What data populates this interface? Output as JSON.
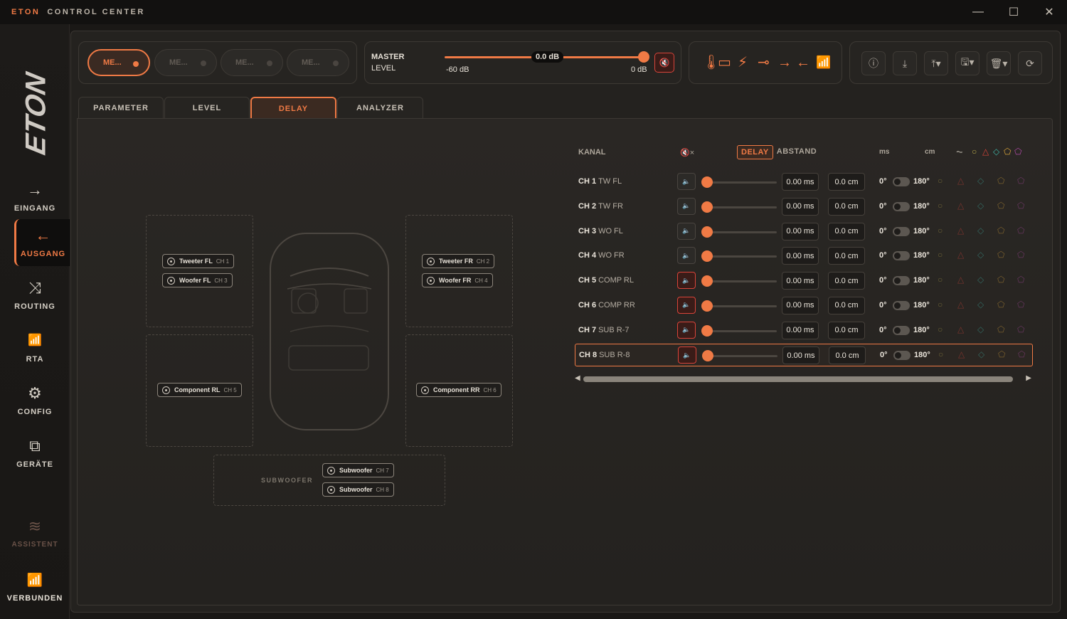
{
  "app": {
    "brand": "ETON",
    "title": "CONTROL CENTER"
  },
  "window": {
    "minimize": "—",
    "maximize": "☐",
    "close": "✕"
  },
  "sidebar": {
    "logo": "ETON",
    "items": [
      {
        "label": "EINGANG",
        "icon": "→"
      },
      {
        "label": "AUSGANG",
        "icon": "←"
      },
      {
        "label": "ROUTING",
        "icon": "⤨"
      },
      {
        "label": "RTA",
        "icon": "📶"
      },
      {
        "label": "CONFIG",
        "icon": "⚙"
      },
      {
        "label": "GERÄTE",
        "icon": "⧉"
      },
      {
        "label": "ASSISTENT",
        "icon": "≋"
      },
      {
        "label": "VERBUNDEN",
        "icon": "📶"
      }
    ]
  },
  "memories": [
    {
      "label": "ME...",
      "active": true
    },
    {
      "label": "ME...",
      "active": false
    },
    {
      "label": "ME...",
      "active": false
    },
    {
      "label": "ME...",
      "active": false
    }
  ],
  "master": {
    "title": "MASTER",
    "subtitle": "LEVEL",
    "min": "-60 dB",
    "max": "0 dB",
    "value": "0.0 dB",
    "level": 1.0,
    "mute_icon": "🔇"
  },
  "status_icons": [
    "🌡",
    "▭",
    "⚡",
    "⊸",
    "→",
    "←",
    "📶"
  ],
  "tools": [
    "ⓘ",
    "⤓",
    "⤒▾",
    "🖫▾",
    "🗑▾",
    "⟳"
  ],
  "tabs": [
    {
      "label": "PARAMETER",
      "active": false
    },
    {
      "label": "LEVEL",
      "active": false
    },
    {
      "label": "DELAY",
      "active": true
    },
    {
      "label": "ANALYZER",
      "active": false
    }
  ],
  "car": {
    "front_left": [
      {
        "name": "Tweeter FL",
        "ch": "CH 1"
      },
      {
        "name": "Woofer FL",
        "ch": "CH 3"
      }
    ],
    "front_right": [
      {
        "name": "Tweeter FR",
        "ch": "CH 2"
      },
      {
        "name": "Woofer FR",
        "ch": "CH 4"
      }
    ],
    "rear_left": {
      "name": "Component RL",
      "ch": "CH 5"
    },
    "rear_right": {
      "name": "Component RR",
      "ch": "CH 6"
    },
    "subwoofer_label": "SUBWOOFER",
    "subwoofers": [
      {
        "name": "Subwoofer",
        "ch": "CH 7"
      },
      {
        "name": "Subwoofer",
        "ch": "CH 8"
      }
    ]
  },
  "delay_table": {
    "headers": {
      "kanal": "KANAL",
      "mute": "🔇×",
      "delay": "DELAY",
      "abstand": "ABSTAND",
      "ms": "ms",
      "cm": "cm",
      "phase_icon": "⏦"
    },
    "header_shapes": [
      "○",
      "△",
      "◇",
      "⬠",
      "⬠"
    ],
    "phase_labels": {
      "a": "0°",
      "b": "180°"
    },
    "rows": [
      {
        "ch": "CH 1",
        "name": "TW FL",
        "muted": false,
        "ms": "0.00 ms",
        "cm": "0.0 cm"
      },
      {
        "ch": "CH 2",
        "name": "TW FR",
        "muted": false,
        "ms": "0.00 ms",
        "cm": "0.0 cm"
      },
      {
        "ch": "CH 3",
        "name": "WO FL",
        "muted": false,
        "ms": "0.00 ms",
        "cm": "0.0 cm"
      },
      {
        "ch": "CH 4",
        "name": "WO FR",
        "muted": false,
        "ms": "0.00 ms",
        "cm": "0.0 cm"
      },
      {
        "ch": "CH 5",
        "name": "COMP RL",
        "muted": true,
        "ms": "0.00 ms",
        "cm": "0.0 cm"
      },
      {
        "ch": "CH 6",
        "name": "COMP RR",
        "muted": true,
        "ms": "0.00 ms",
        "cm": "0.0 cm"
      },
      {
        "ch": "CH 7",
        "name": "SUB R-7",
        "muted": true,
        "ms": "0.00 ms",
        "cm": "0.0 cm"
      },
      {
        "ch": "CH 8",
        "name": "SUB R-8",
        "muted": true,
        "ms": "0.00 ms",
        "cm": "0.0 cm",
        "selected": true
      }
    ],
    "mute_glyph": "🔈",
    "shape_colors": [
      "#b8a84a",
      "#d9443a",
      "#3fb5a8",
      "#d9a43a",
      "#b24aa8"
    ]
  },
  "scroll": {
    "left": "◀",
    "right": "▶"
  }
}
